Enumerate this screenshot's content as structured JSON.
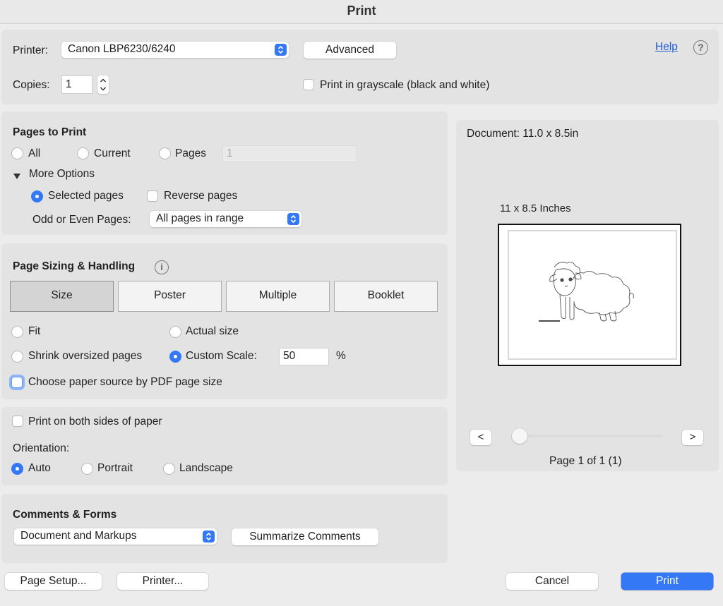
{
  "window": {
    "title": "Print"
  },
  "printer": {
    "label": "Printer:",
    "selected": "Canon LBP6230/6240",
    "advanced_label": "Advanced",
    "help_label": "Help",
    "help_icon_glyph": "?",
    "copies_label": "Copies:",
    "copies_value": "1",
    "grayscale_label": "Print in grayscale (black and white)"
  },
  "pages_to_print": {
    "heading": "Pages to Print",
    "options": [
      "All",
      "Current",
      "Pages"
    ],
    "pages_placeholder": "1",
    "more_options_label": "More Options",
    "selected_pages_label": "Selected pages",
    "reverse_pages_label": "Reverse pages",
    "odd_even_label": "Odd or Even Pages:",
    "odd_even_selected": "All pages in range"
  },
  "page_sizing": {
    "heading": "Page Sizing & Handling",
    "info_icon_glyph": "i",
    "tabs": [
      "Size",
      "Poster",
      "Multiple",
      "Booklet"
    ],
    "active_tab": "Size",
    "fit_label": "Fit",
    "actual_size_label": "Actual size",
    "shrink_label": "Shrink oversized pages",
    "custom_scale_label": "Custom Scale:",
    "custom_scale_value": "50",
    "percent_label": "%",
    "paper_source_label": "Choose paper source by PDF page size"
  },
  "orientation": {
    "duplex_label": "Print on both sides of paper",
    "heading": "Orientation:",
    "options": [
      "Auto",
      "Portrait",
      "Landscape"
    ],
    "selected": "Auto"
  },
  "comments_forms": {
    "heading": "Comments & Forms",
    "selected": "Document and Markups",
    "summarize_label": "Summarize Comments"
  },
  "preview": {
    "document_size": "Document: 11.0 x 8.5in",
    "page_size_label": "11 x 8.5 Inches",
    "prev_label": "<",
    "next_label": ">",
    "page_indicator": "Page 1 of 1 (1)",
    "slider_position": 0,
    "thumbnail": "sheep-drawing"
  },
  "footer": {
    "page_setup_label": "Page Setup...",
    "printer_label": "Printer...",
    "cancel_label": "Cancel",
    "print_label": "Print"
  },
  "colors": {
    "accent": "#3478f6",
    "link": "#1a5bd8",
    "panel": "#e3e3e3",
    "background": "#ececec"
  }
}
